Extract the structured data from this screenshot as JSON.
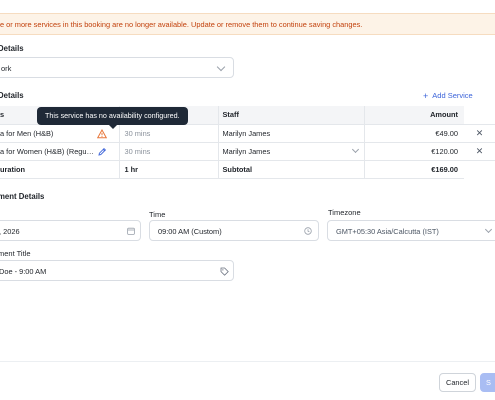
{
  "banner": {
    "message": "e or more services in this booking are no longer available. Update or remove them to continue saving changes."
  },
  "booking_details": {
    "title": "Details",
    "location_value": "ork"
  },
  "service_details": {
    "title": "Details",
    "add_service_label": "Add Service",
    "columns": [
      "s",
      "",
      "Staff",
      "Amount"
    ],
    "rows": [
      {
        "service": "a for Men (H&B)",
        "duration": "30 mins",
        "staff": "Marilyn James",
        "amount": "€49.00"
      },
      {
        "service": "a for Women (H&B) (Regu…",
        "duration": "30 mins",
        "staff": "Marilyn James",
        "amount": "€120.00"
      }
    ],
    "total": {
      "label": "uration",
      "duration": "1 hr",
      "subtotal_label": "Subtotal",
      "subtotal": "€169.00"
    },
    "tooltip": "This service has no availability configured."
  },
  "appointment_details": {
    "title": "ment Details",
    "date_value": ", 2026",
    "time_label": "Time",
    "time_value": "09:00 AM (Custom)",
    "timezone_label": "Timezone",
    "timezone_value": "GMT+05:30 Asia/Calcutta (IST)",
    "appt_title_label": "ment Title",
    "appt_title_value": "Doe - 9:00 AM"
  },
  "footer": {
    "cancel_label": "Cancel",
    "save_label": "S"
  },
  "colors": {
    "banner_bg": "#fdf3e7",
    "banner_text": "#c2410c",
    "accent": "#3b63d9",
    "warning": "#e8773a"
  }
}
